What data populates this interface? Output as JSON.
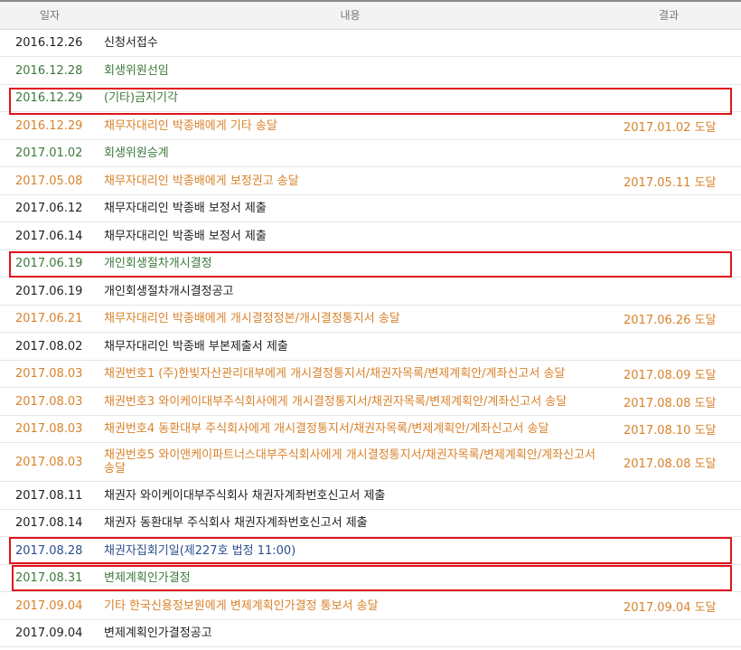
{
  "header": {
    "date": "일자",
    "content": "내용",
    "result": "결과"
  },
  "colors": {
    "black": "#222222",
    "green": "#3d7a3a",
    "orange": "#d9822b",
    "blue": "#2a4f8f",
    "highlight": "#e0141e"
  },
  "rows": [
    {
      "date": "2016.12.26",
      "content": "신청서접수",
      "result": "",
      "color": "black",
      "highlighted": false
    },
    {
      "date": "2016.12.28",
      "content": "회생위원선임",
      "result": "",
      "color": "green",
      "highlighted": false
    },
    {
      "date": "2016.12.29",
      "content": "(기타)금지기각",
      "result": "",
      "color": "green",
      "highlighted": true
    },
    {
      "date": "2016.12.29",
      "content": "채무자대리인 박종배에게 기타 송달",
      "result": "2017.01.02 도달",
      "color": "orange",
      "highlighted": false
    },
    {
      "date": "2017.01.02",
      "content": "회생위원승계",
      "result": "",
      "color": "green",
      "highlighted": false
    },
    {
      "date": "2017.05.08",
      "content": "채무자대리인 박종배에게 보정권고 송달",
      "result": "2017.05.11 도달",
      "color": "orange",
      "highlighted": false
    },
    {
      "date": "2017.06.12",
      "content": "채무자대리인 박종배 보정서 제출",
      "result": "",
      "color": "black",
      "highlighted": false
    },
    {
      "date": "2017.06.14",
      "content": "채무자대리인 박종배 보정서 제출",
      "result": "",
      "color": "black",
      "highlighted": false
    },
    {
      "date": "2017.06.19",
      "content": "개인회생절차개시결정",
      "result": "",
      "color": "green",
      "highlighted": true
    },
    {
      "date": "2017.06.19",
      "content": "개인회생절차개시결정공고",
      "result": "",
      "color": "black",
      "highlighted": false
    },
    {
      "date": "2017.06.21",
      "content": "채무자대리인 박종배에게 개시결정정본/개시결정통지서 송달",
      "result": "2017.06.26 도달",
      "color": "orange",
      "highlighted": false
    },
    {
      "date": "2017.08.02",
      "content": "채무자대리인 박종배 부본제출서 제출",
      "result": "",
      "color": "black",
      "highlighted": false
    },
    {
      "date": "2017.08.03",
      "content": "채권번호1 (주)한빛자산관리대부에게 개시결정통지서/채권자목록/변제계획안/계좌신고서 송달",
      "result": "2017.08.09 도달",
      "color": "orange",
      "highlighted": false
    },
    {
      "date": "2017.08.03",
      "content": "채권번호3 와이케이대부주식회사에게 개시결정통지서/채권자목록/변제계획안/계좌신고서 송달",
      "result": "2017.08.08 도달",
      "color": "orange",
      "highlighted": false
    },
    {
      "date": "2017.08.03",
      "content": "채권번호4 동환대부 주식회사에게 개시결정통지서/채권자목록/변제계획안/계좌신고서 송달",
      "result": "2017.08.10 도달",
      "color": "orange",
      "highlighted": false
    },
    {
      "date": "2017.08.03",
      "content": "채권번호5 와이앤케이파트너스대부주식회사에게 개시결정통지서/채권자목록/변제계획안/계좌신고서 송달",
      "result": "2017.08.08 도달",
      "color": "orange",
      "highlighted": false
    },
    {
      "date": "2017.08.11",
      "content": "채권자 와이케이대부주식회사 채권자계좌번호신고서 제출",
      "result": "",
      "color": "black",
      "highlighted": false
    },
    {
      "date": "2017.08.14",
      "content": "채권자 동환대부 주식회사 채권자계좌번호신고서 제출",
      "result": "",
      "color": "black",
      "highlighted": false
    },
    {
      "date": "2017.08.28",
      "content": "채권자집회기일(제227호 법정 11:00)",
      "result": "",
      "color": "blue",
      "highlighted": true
    },
    {
      "date": "2017.08.31",
      "content": "변제계획인가결정",
      "result": "",
      "color": "green",
      "highlighted": true
    },
    {
      "date": "2017.09.04",
      "content": "기타 한국신용정보원에게 변제계획인가결정 통보서 송달",
      "result": "2017.09.04 도달",
      "color": "orange",
      "highlighted": false
    },
    {
      "date": "2017.09.04",
      "content": "변제계획인가결정공고",
      "result": "",
      "color": "black",
      "highlighted": false
    }
  ]
}
